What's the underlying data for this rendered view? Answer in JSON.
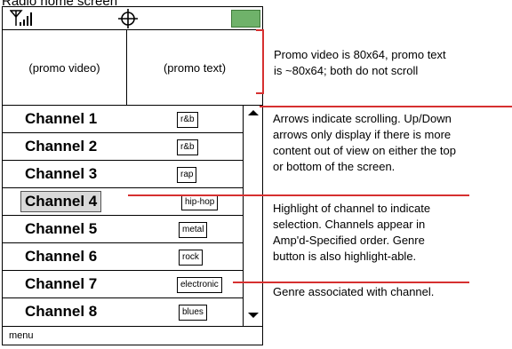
{
  "title": "Radio home screen",
  "statusbar": {
    "signal_icon": "signal-strength-icon",
    "center_icon": "crosshair-icon",
    "battery_color": "#6fb26a"
  },
  "promo": {
    "video_label": "(promo video)",
    "text_label": "(promo text)"
  },
  "channels": [
    {
      "name": "Channel 1",
      "genre": "r&b"
    },
    {
      "name": "Channel 2",
      "genre": "r&b"
    },
    {
      "name": "Channel 3",
      "genre": "rap"
    },
    {
      "name": "Channel 4",
      "genre": "hip-hop"
    },
    {
      "name": "Channel 5",
      "genre": "metal"
    },
    {
      "name": "Channel 6",
      "genre": "rock"
    },
    {
      "name": "Channel 7",
      "genre": "electronic"
    },
    {
      "name": "Channel 8",
      "genre": "blues"
    }
  ],
  "selected_channel": "Channel 4",
  "menu_label": "menu",
  "annotations": {
    "promo": [
      "Promo video is 80x64, promo text",
      "is ~80x64; both do not scroll"
    ],
    "arrows": [
      "Arrows indicate scrolling. Up/Down",
      "arrows only display if there is more",
      "content out of view on either the top",
      "or bottom of the screen."
    ],
    "highlight": [
      "Highlight of channel to indicate",
      "selection. Channels appear in",
      "Amp'd-Specified order. Genre",
      "button is also highlight-able."
    ],
    "genre": [
      "Genre associated with channel."
    ]
  },
  "colors": {
    "annotation_line": "#d63030"
  }
}
